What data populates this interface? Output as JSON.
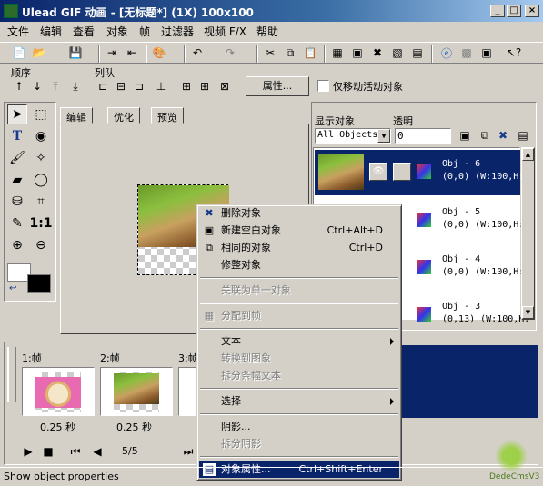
{
  "window": {
    "title": "Ulead GIF 动画 - [无标题*] (1X) 100x100",
    "controls": {
      "minimize": "_",
      "maximize": "□",
      "close": "×"
    }
  },
  "menubar": [
    "文件",
    "编辑",
    "查看",
    "对象",
    "帧",
    "过滤器",
    "视频 F/X",
    "帮助"
  ],
  "toolbar2": {
    "order_label": "顺序",
    "align_label": "列队",
    "properties_button": "属性...",
    "only_move_active_label": "仅移动活动对象",
    "only_move_active_checked": false
  },
  "tabs": [
    "编辑",
    "优化",
    "预览"
  ],
  "right_panel": {
    "show_objects_label": "显示对象",
    "opacity_label": "透明",
    "filter_value": "All Objects",
    "opacity_value": "0",
    "objects": [
      {
        "name": "Obj - 6",
        "info": "(0,0) (W:100,H:1",
        "selected": true
      },
      {
        "name": "Obj - 5",
        "info": "(0,0) (W:100,H:1",
        "selected": false
      },
      {
        "name": "Obj - 4",
        "info": "(0,0) (W:100,H:1",
        "selected": false
      },
      {
        "name": "Obj - 3",
        "info": "(0,13) (W:100,H:",
        "selected": false
      }
    ]
  },
  "frames": {
    "items": [
      {
        "label": "1:帧",
        "delay": "0.25 秒"
      },
      {
        "label": "2:帧",
        "delay": "0.25 秒"
      },
      {
        "label": "3:帧",
        "delay": ""
      }
    ],
    "counter": "5/5"
  },
  "context_menu": {
    "items": [
      {
        "label": "删除对象",
        "shortcut": "",
        "icon": "delete-x-icon",
        "disabled": false
      },
      {
        "label": "新建空白对象",
        "shortcut": "Ctrl+Alt+D",
        "icon": "new-object-icon",
        "disabled": false
      },
      {
        "label": "相同的对象",
        "shortcut": "Ctrl+D",
        "icon": "duplicate-object-icon",
        "disabled": false
      },
      {
        "label": "修整对象",
        "shortcut": "",
        "icon": "",
        "disabled": false
      },
      {
        "label": "关联为单一对象",
        "shortcut": "",
        "icon": "",
        "disabled": true
      },
      {
        "label": "分配到帧",
        "shortcut": "",
        "icon": "distribute-frames-icon",
        "disabled": true
      },
      {
        "label": "文本",
        "shortcut": "",
        "icon": "",
        "disabled": false,
        "submenu": true
      },
      {
        "label": "转换到图象",
        "shortcut": "",
        "icon": "",
        "disabled": true
      },
      {
        "label": "拆分条幅文本",
        "shortcut": "",
        "icon": "",
        "disabled": true
      },
      {
        "label": "选择",
        "shortcut": "",
        "icon": "",
        "disabled": false,
        "submenu": true
      },
      {
        "label": "阴影...",
        "shortcut": "",
        "icon": "",
        "disabled": false
      },
      {
        "label": "拆分阴影",
        "shortcut": "",
        "icon": "",
        "disabled": true
      },
      {
        "label": "对象属性...",
        "shortcut": "Ctrl+Shift+Enter",
        "icon": "object-properties-icon",
        "disabled": false,
        "highlighted": true
      }
    ]
  },
  "status_bar": {
    "text": "Show object properties"
  },
  "watermark": "DedeCmsV3"
}
